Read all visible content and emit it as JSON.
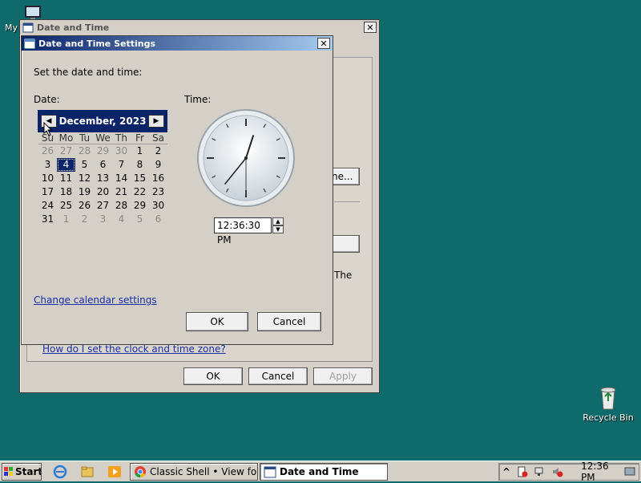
{
  "desktop": {
    "my_computer_label": "My",
    "recycle_bin_label": "Recycle Bin"
  },
  "outer_window": {
    "title": "Date and Time",
    "close_glyph": "✕",
    "partial_button_label": "ne...",
    "partial_text": "The",
    "link_help": "How do I set the clock and time zone?",
    "ok_label": "OK",
    "cancel_label": "Cancel",
    "apply_label": "Apply"
  },
  "dialog": {
    "title": "Date and Time Settings",
    "close_glyph": "✕",
    "instruction": "Set the date and time:",
    "date_label": "Date:",
    "time_label": "Time:",
    "calendar": {
      "month_year": "December, 2023",
      "prev_glyph": "◀",
      "next_glyph": "▶",
      "weekdays": [
        "Su",
        "Mo",
        "Tu",
        "We",
        "Th",
        "Fr",
        "Sa"
      ],
      "weeks": [
        [
          {
            "d": "26",
            "o": true
          },
          {
            "d": "27",
            "o": true
          },
          {
            "d": "28",
            "o": true
          },
          {
            "d": "29",
            "o": true
          },
          {
            "d": "30",
            "o": true
          },
          {
            "d": "1",
            "o": false
          },
          {
            "d": "2",
            "o": false
          }
        ],
        [
          {
            "d": "3",
            "o": false
          },
          {
            "d": "4",
            "o": false,
            "sel": true
          },
          {
            "d": "5",
            "o": false
          },
          {
            "d": "6",
            "o": false
          },
          {
            "d": "7",
            "o": false
          },
          {
            "d": "8",
            "o": false
          },
          {
            "d": "9",
            "o": false
          }
        ],
        [
          {
            "d": "10",
            "o": false
          },
          {
            "d": "11",
            "o": false
          },
          {
            "d": "12",
            "o": false
          },
          {
            "d": "13",
            "o": false
          },
          {
            "d": "14",
            "o": false
          },
          {
            "d": "15",
            "o": false
          },
          {
            "d": "16",
            "o": false
          }
        ],
        [
          {
            "d": "17",
            "o": false
          },
          {
            "d": "18",
            "o": false
          },
          {
            "d": "19",
            "o": false
          },
          {
            "d": "20",
            "o": false
          },
          {
            "d": "21",
            "o": false
          },
          {
            "d": "22",
            "o": false
          },
          {
            "d": "23",
            "o": false
          }
        ],
        [
          {
            "d": "24",
            "o": false
          },
          {
            "d": "25",
            "o": false
          },
          {
            "d": "26",
            "o": false
          },
          {
            "d": "27",
            "o": false
          },
          {
            "d": "28",
            "o": false
          },
          {
            "d": "29",
            "o": false
          },
          {
            "d": "30",
            "o": false
          }
        ],
        [
          {
            "d": "31",
            "o": false
          },
          {
            "d": "1",
            "o": true
          },
          {
            "d": "2",
            "o": true
          },
          {
            "d": "3",
            "o": true
          },
          {
            "d": "4",
            "o": true
          },
          {
            "d": "5",
            "o": true
          },
          {
            "d": "6",
            "o": true
          }
        ]
      ]
    },
    "time_value": "12:36:30 PM",
    "spin_up": "▲",
    "spin_down": "▼",
    "clock": {
      "hour": 12,
      "minute": 36,
      "second": 30
    },
    "link_calendar": "Change calendar settings",
    "ok_label": "OK",
    "cancel_label": "Cancel"
  },
  "taskbar": {
    "start_label": "Start",
    "tasks": [
      {
        "label": "Classic Shell • View foru..."
      },
      {
        "label": "Date and Time"
      }
    ],
    "tray_chevron": "^",
    "clock": "12:36 PM"
  },
  "colors": {
    "desktop": "#0f6b6b",
    "selection": "#0a246a",
    "link": "#1a2ea8"
  }
}
